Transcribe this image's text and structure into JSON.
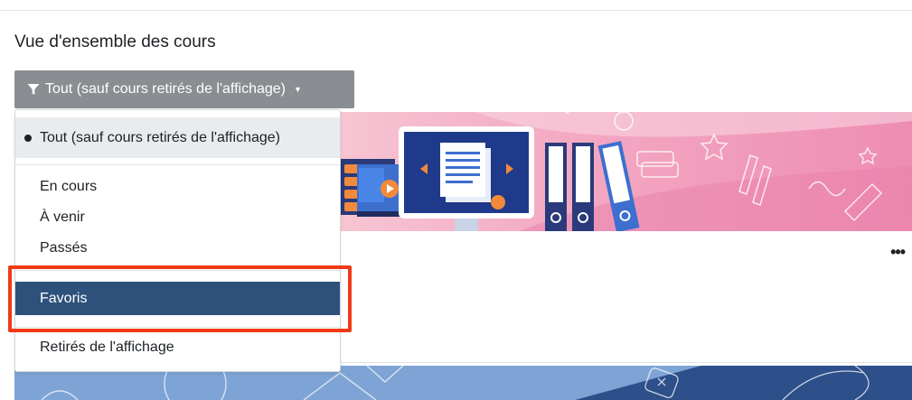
{
  "page": {
    "section_title": "Vue d'ensemble des cours"
  },
  "filter": {
    "button_label": "Tout (sauf cours retirés de l'affichage)",
    "icon": "funnel-icon",
    "caret_icon": "caret-down-icon"
  },
  "dropdown": {
    "items": [
      {
        "label": "Tout (sauf cours retirés de l'affichage)",
        "state": "selected"
      },
      {
        "label": "En cours",
        "state": "normal"
      },
      {
        "label": "À venir",
        "state": "normal"
      },
      {
        "label": "Passés",
        "state": "normal"
      },
      {
        "label": "Favoris",
        "state": "hovered"
      },
      {
        "label": "Retirés de l'affichage",
        "state": "normal"
      }
    ]
  },
  "course_card": {
    "more_label": "•••"
  },
  "colors": {
    "filter_button_bg": "#8a8d91",
    "hover_item_bg": "#2e517c",
    "selected_item_bg": "#e9ecef",
    "highlight_border": "#f03a17",
    "banner_pink": "#f2a0bd",
    "banner_blue": "#7ea4d6"
  }
}
